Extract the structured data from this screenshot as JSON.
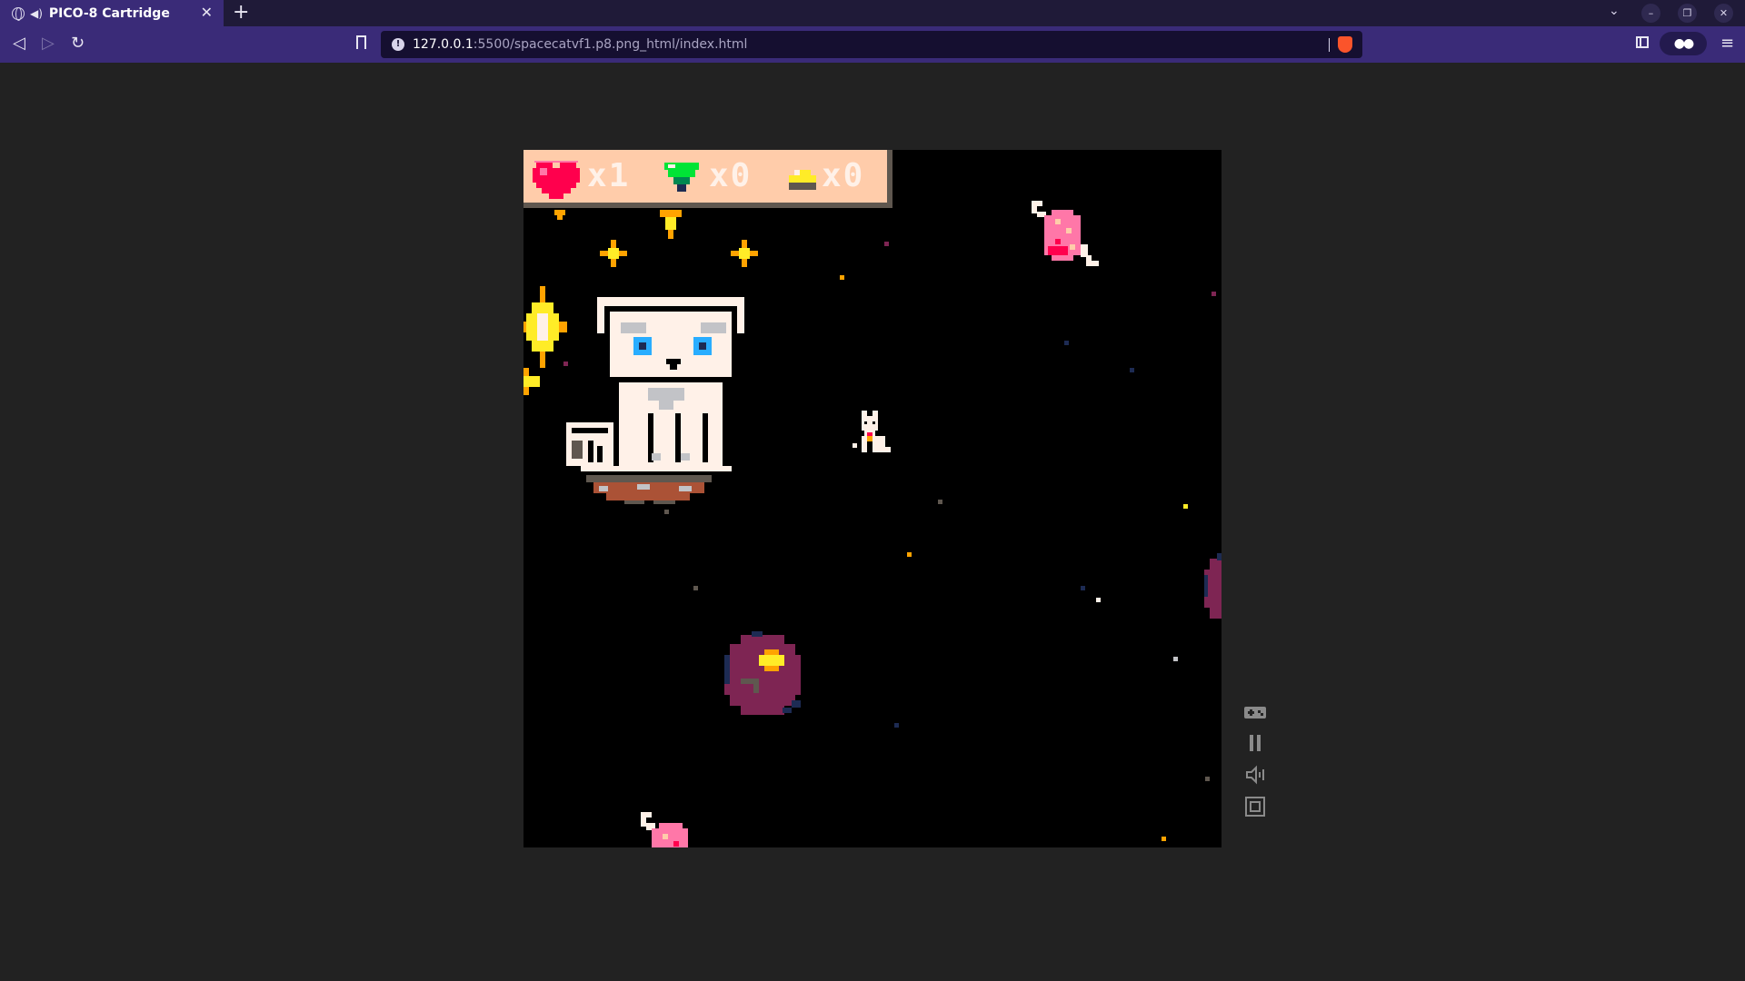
{
  "browser": {
    "tab_title": "PICO-8 Cartridge",
    "tab_close": "✕",
    "new_tab": "+",
    "url_host": "127.0.0.1",
    "url_rest": ":5500/spacecatvf1.p8.png_html/index.html",
    "back": "◁",
    "forward": "▷",
    "reload": "↻",
    "tablist_icon": "⌄",
    "minimize": "–",
    "restore": "❐",
    "close": "✕",
    "menu_icon": "≡",
    "wallet_icon": "●●"
  },
  "hud": {
    "lives": "x1",
    "gems": "x0",
    "coins": "x0"
  },
  "colors": {
    "page_bg": "#222222",
    "hud_bg": "#ffccaa",
    "heart": "#ff004d",
    "gem": "#00e436",
    "coin": "#ffec27",
    "planet": "#7e2553"
  }
}
